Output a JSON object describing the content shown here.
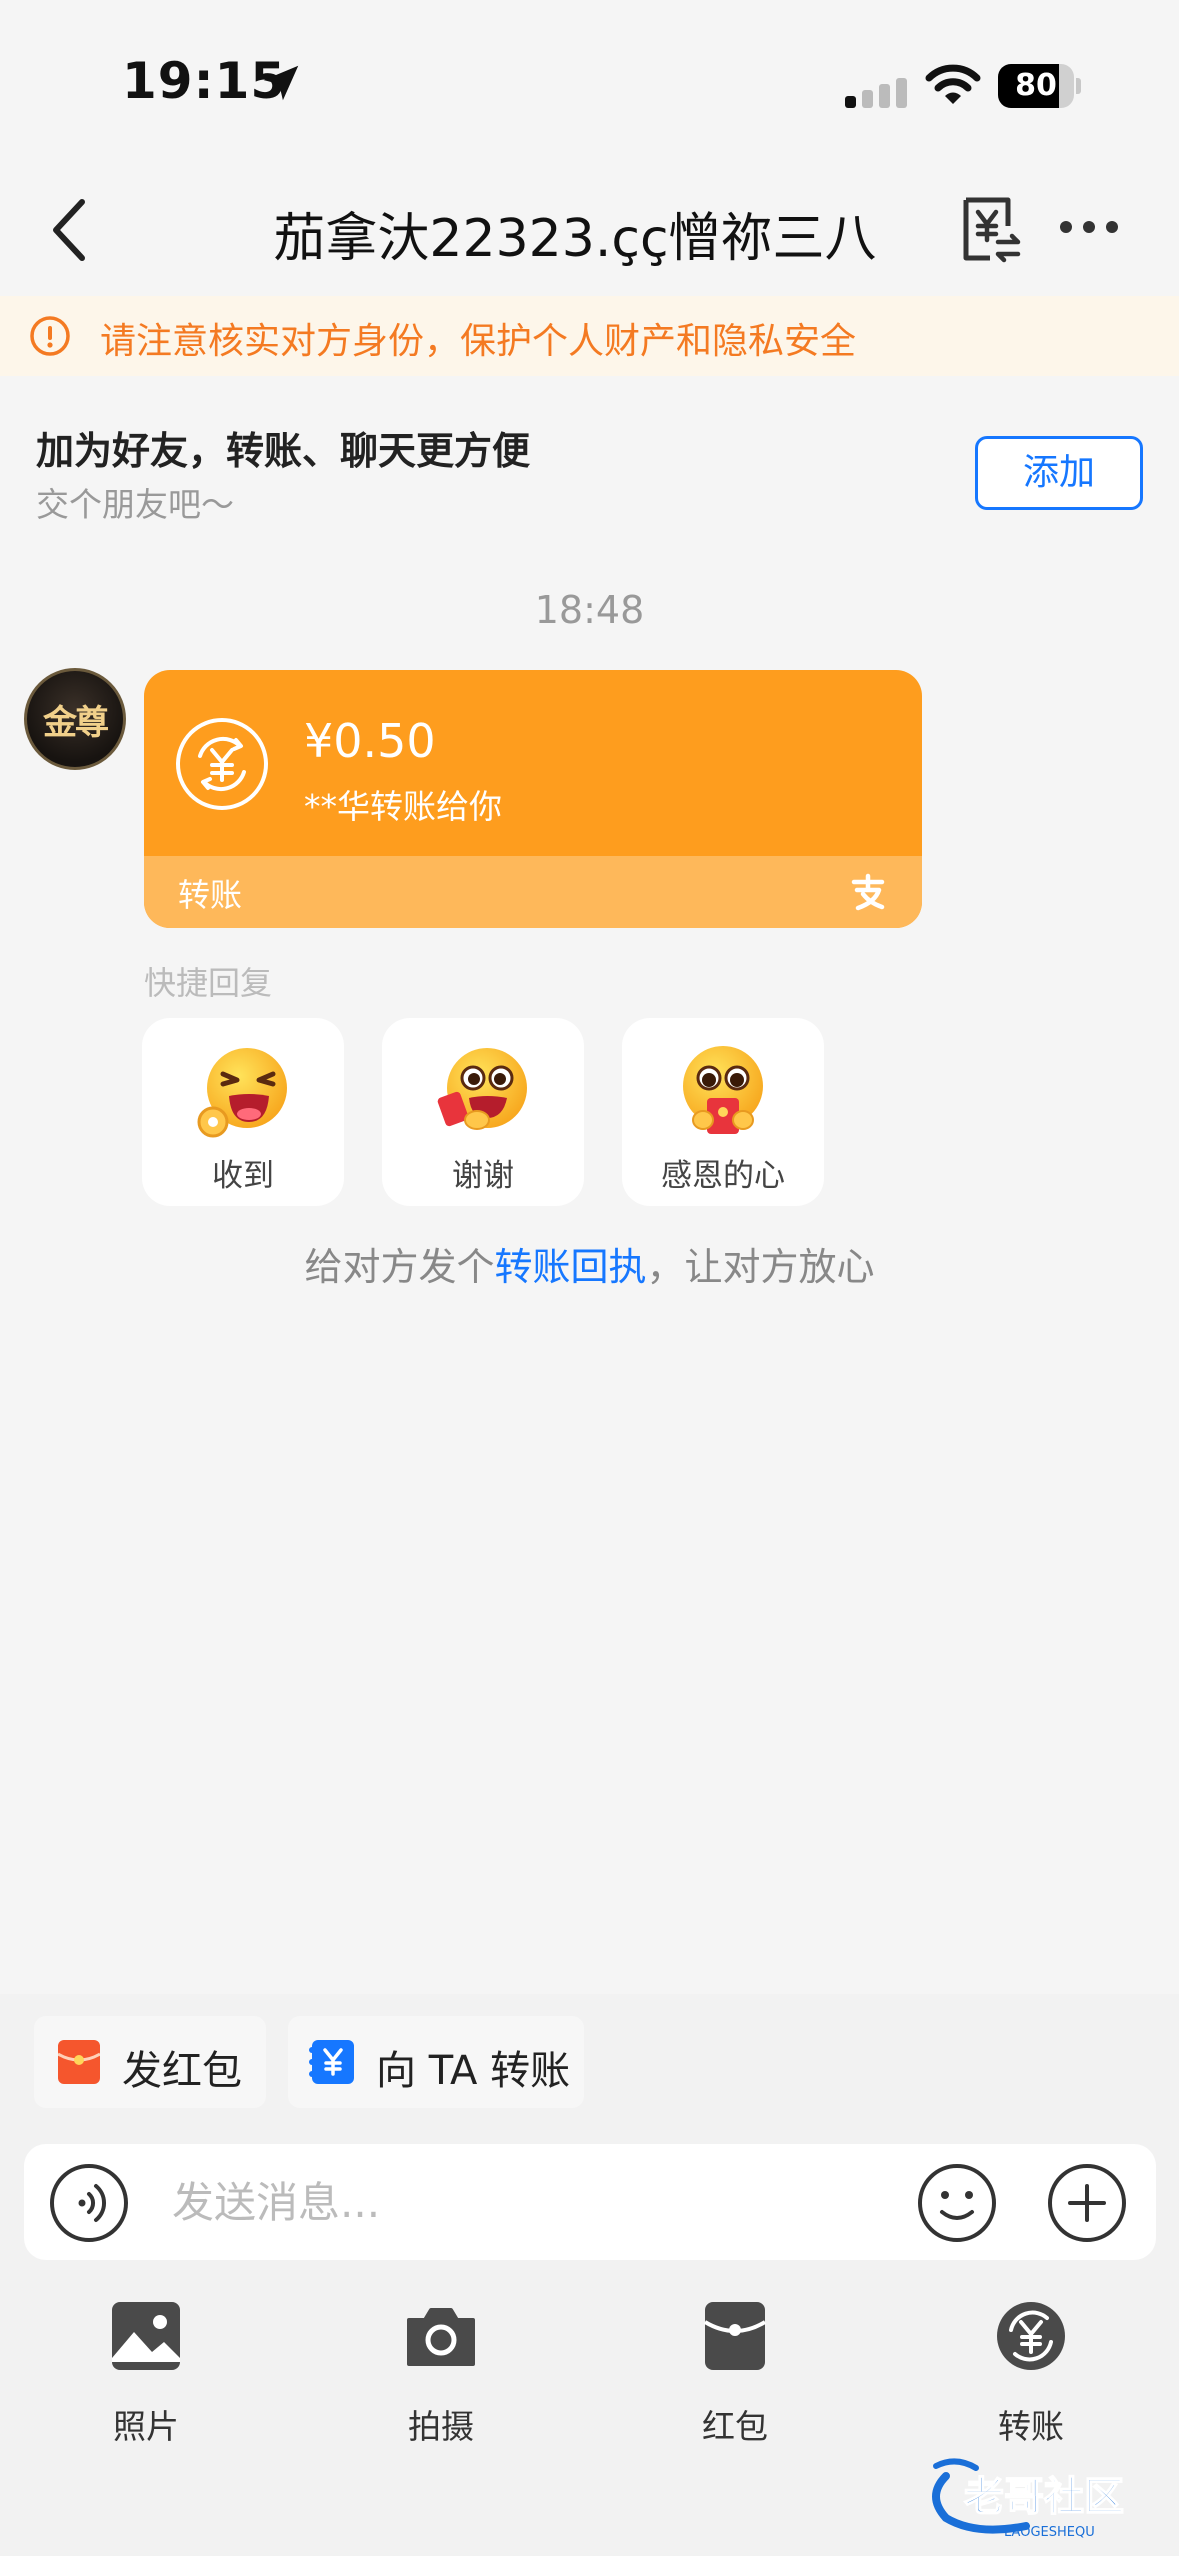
{
  "status_bar": {
    "time": "19:15",
    "battery_level": 80,
    "battery_label": "80"
  },
  "nav": {
    "title": "茄拿汏22323.çç憎祢三八"
  },
  "warning": {
    "text": "请注意核实对方身份，保护个人财产和隐私安全",
    "color": "#f47a22"
  },
  "add_friend": {
    "title": "加为好友，转账、聊天更方便",
    "subtitle": "交个朋友吧～",
    "button": "添加"
  },
  "chat": {
    "timestamp": "18:48",
    "avatar_text": "金尊",
    "transfer": {
      "amount": "¥0.50",
      "description": "**华转账给你",
      "footer": "转账",
      "color": "#fe9d1e"
    },
    "quick_reply_label": "快捷回复",
    "quick_replies": [
      {
        "label": "收到",
        "icon": "ok-hand-emoji"
      },
      {
        "label": "谢谢",
        "icon": "grateful-emoji"
      },
      {
        "label": "感恩的心",
        "icon": "heart-envelope-emoji"
      }
    ],
    "receipt": {
      "prefix": "给对方发个",
      "link": "转账回执",
      "suffix": "，让对方放心"
    }
  },
  "shortcuts": [
    {
      "label": "发红包",
      "icon": "red-envelope-icon"
    },
    {
      "label": "向 TA 转账",
      "icon": "yuan-card-icon"
    }
  ],
  "input": {
    "placeholder": "发送消息..."
  },
  "toolbar": [
    {
      "label": "照片",
      "icon": "photo-icon"
    },
    {
      "label": "拍摄",
      "icon": "camera-icon"
    },
    {
      "label": "红包",
      "icon": "red-packet-icon"
    },
    {
      "label": "转账",
      "icon": "transfer-icon"
    }
  ],
  "watermark": {
    "text": "老哥社区",
    "sub": "LAOGESHEQU"
  },
  "accent_color": "#1677ff"
}
